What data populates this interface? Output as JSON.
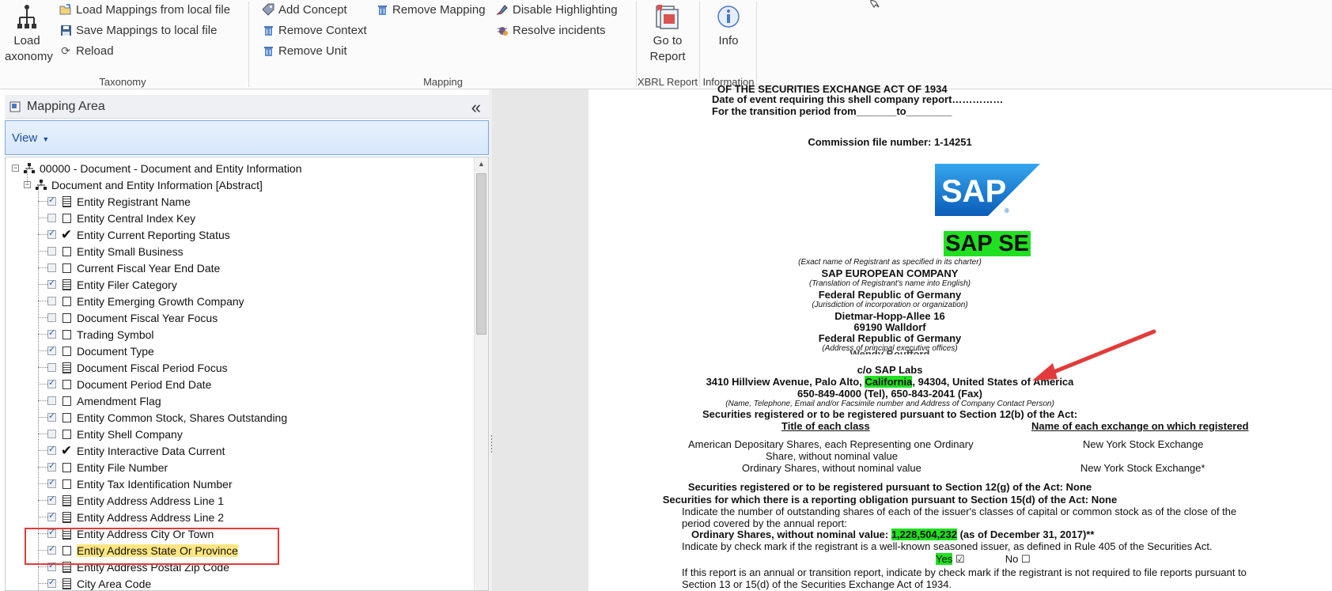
{
  "ribbon": {
    "taxonomy": {
      "load_taxonomy": "Load Taxonomy",
      "load_label_line1": "Load",
      "load_label_line2": "axonomy",
      "load_mappings": "Load Mappings from local file",
      "save_mappings": "Save Mappings to local file",
      "reload": "Reload",
      "group_label": "Taxonomy"
    },
    "mapping": {
      "add_concept": "Add Concept",
      "remove_context": "Remove Context",
      "remove_unit": "Remove Unit",
      "remove_mapping": "Remove Mapping",
      "disable_highlighting": "Disable Highlighting",
      "resolve_incidents": "Resolve incidents",
      "group_label": "Mapping"
    },
    "xbrl_report": {
      "go_to_line1": "Go to",
      "go_to_line2": "Report",
      "group_label": "XBRL Report"
    },
    "information": {
      "info": "Info",
      "group_label": "Information"
    }
  },
  "mapping_area": {
    "title": "Mapping Area",
    "view_label": "View",
    "tree": [
      {
        "label": "00000 - Document - Document and Entity Information",
        "type": "root",
        "checked": null
      },
      {
        "label": "Document and Entity Information [Abstract]",
        "type": "abstract",
        "checked": null
      },
      {
        "label": "Entity Registrant Name",
        "type": "doc",
        "checked": true
      },
      {
        "label": "Entity Central Index Key",
        "type": "box",
        "checked": false
      },
      {
        "label": "Entity Current Reporting Status",
        "type": "check",
        "checked": true
      },
      {
        "label": "Entity Small Business",
        "type": "box",
        "checked": false
      },
      {
        "label": "Current Fiscal Year End Date",
        "type": "box",
        "checked": false
      },
      {
        "label": "Entity Filer Category",
        "type": "doc",
        "checked": true
      },
      {
        "label": "Entity Emerging Growth Company",
        "type": "box",
        "checked": false
      },
      {
        "label": "Document Fiscal Year Focus",
        "type": "box",
        "checked": false
      },
      {
        "label": "Trading Symbol",
        "type": "box",
        "checked": true
      },
      {
        "label": "Document Type",
        "type": "box",
        "checked": true
      },
      {
        "label": "Document Fiscal Period Focus",
        "type": "doc",
        "checked": false
      },
      {
        "label": "Document Period End Date",
        "type": "box",
        "checked": true
      },
      {
        "label": "Amendment Flag",
        "type": "box",
        "checked": false
      },
      {
        "label": "Entity Common Stock, Shares Outstanding",
        "type": "box",
        "checked": true
      },
      {
        "label": "Entity Shell Company",
        "type": "box",
        "checked": false
      },
      {
        "label": "Entity Interactive Data Current",
        "type": "check",
        "checked": true
      },
      {
        "label": "Entity File Number",
        "type": "box",
        "checked": true
      },
      {
        "label": "Entity Tax Identification Number",
        "type": "box",
        "checked": true
      },
      {
        "label": "Entity Address Address Line 1",
        "type": "doc",
        "checked": true
      },
      {
        "label": "Entity Address Address Line 2",
        "type": "doc",
        "checked": true
      },
      {
        "label": "Entity Address City Or Town",
        "type": "doc",
        "checked": true
      },
      {
        "label": "Entity Address State Or Province",
        "type": "box",
        "checked": true,
        "highlighted": true
      },
      {
        "label": "Entity Address Postal Zip Code",
        "type": "doc",
        "checked": true
      },
      {
        "label": "City Area Code",
        "type": "doc",
        "checked": true
      }
    ]
  },
  "document": {
    "line_cutoff": "OF THE SECURITIES EXCHANGE ACT OF 1934",
    "date_event": "Date of event requiring this shell company report……………",
    "transition": "For the transition period from_______to________",
    "commission": "Commission file number: 1-14251",
    "logo_text": "SAP",
    "company": "SAP SE",
    "exact_name_note": "(Exact name of Registrant as specified in its charter)",
    "translation": "SAP EUROPEAN COMPANY",
    "translation_note": "(Translation of Registrant's name into English)",
    "jurisdiction": "Federal Republic of Germany",
    "jurisdiction_note": "(Jurisdiction of incorporation or organization)",
    "address1": "Dietmar-Hopp-Allee 16",
    "address2": "69190 Walldorf",
    "address3": "Federal Republic of Germany",
    "address_note": "(Address of principal executive offices)",
    "contact_partial": "Wendy Boufford",
    "care_of": "c/o SAP Labs",
    "street_pre": "3410 Hillview Avenue, Palo Alto, ",
    "state": "California",
    "street_post": ", 94304, United States of America",
    "phone": "650-849-4000 (Tel), 650-843-2041 (Fax)",
    "contact_note": "(Name, Telephone, Email and/or Facsimile number and Address of Company Contact Person)",
    "sec12b": "Securities registered or to be registered pursuant to Section 12(b) of the Act:",
    "col_title": "Title of each class",
    "col_exchange": "Name of each exchange on which registered",
    "class1_line1": "American Depositary Shares, each Representing one Ordinary",
    "class1_line2": "Share, without nominal value",
    "class2": "Ordinary Shares, without nominal value",
    "exchange1": "New York Stock Exchange",
    "exchange2": "New York Stock Exchange*",
    "sec12g": "Securities registered or to be registered pursuant to Section 12(g) of the Act: None",
    "sec15d": "Securities for which there is a reporting obligation pursuant to Section 15(d) of the Act: None",
    "outstanding_l1": "Indicate the number of outstanding shares of each of the issuer's classes of capital or common stock as of the close of the",
    "outstanding_l2": "period covered by the annual report:",
    "ordinary_pre": "Ordinary Shares, without nominal value: ",
    "shares_value": "1,228,504,232",
    "ordinary_post": " (as of December 31, 2017)**",
    "seasoned": "Indicate by check mark if the registrant is a well-known seasoned issuer, as defined in Rule 405 of the Securities Act.",
    "yes": "Yes",
    "yes_mark": "☑",
    "no": "No",
    "no_mark": "☐",
    "annual_l1": "If this report is an annual or transition report, indicate by check mark if the registrant is not required to file reports pursuant to",
    "annual_l2": "Section 13 or 15(d) of the Securities Exchange Act of 1934."
  },
  "colors": {
    "highlight_green": "#21e021",
    "selection_yellow": "#ffe680",
    "callout_red": "#e23b3b",
    "sap_blue": "#1870c6"
  }
}
